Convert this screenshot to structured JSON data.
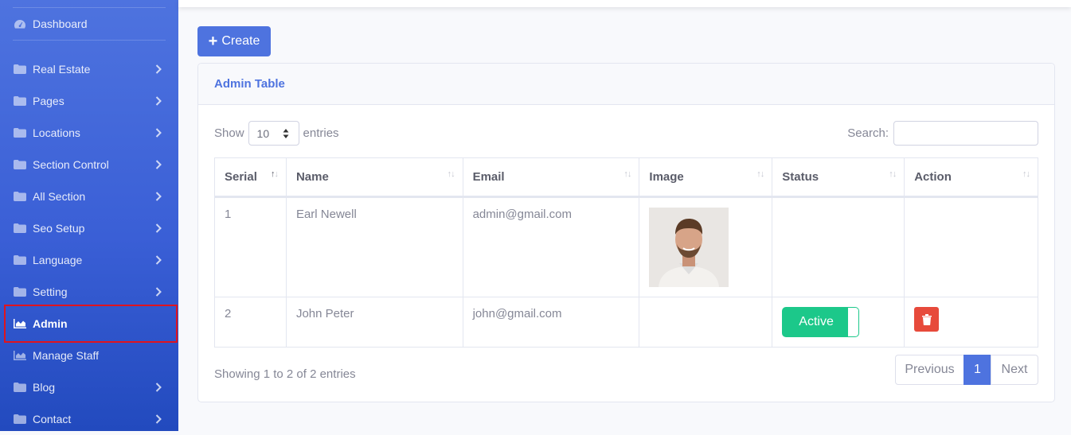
{
  "sidebar": {
    "items": [
      {
        "label": "Dashboard",
        "icon": "tachometer-icon",
        "submenu": false
      },
      {
        "label": "Real Estate",
        "icon": "folder-icon",
        "submenu": true
      },
      {
        "label": "Pages",
        "icon": "folder-icon",
        "submenu": true
      },
      {
        "label": "Locations",
        "icon": "folder-icon",
        "submenu": true
      },
      {
        "label": "Section Control",
        "icon": "folder-icon",
        "submenu": true
      },
      {
        "label": "All Section",
        "icon": "folder-icon",
        "submenu": true
      },
      {
        "label": "Seo Setup",
        "icon": "folder-icon",
        "submenu": true
      },
      {
        "label": "Language",
        "icon": "folder-icon",
        "submenu": true
      },
      {
        "label": "Setting",
        "icon": "folder-icon",
        "submenu": true
      },
      {
        "label": "Admin",
        "icon": "chart-area-icon",
        "submenu": false,
        "active": true
      },
      {
        "label": "Manage Staff",
        "icon": "chart-area-icon",
        "submenu": false
      },
      {
        "label": "Blog",
        "icon": "folder-icon",
        "submenu": true
      },
      {
        "label": "Contact",
        "icon": "folder-icon",
        "submenu": true
      }
    ]
  },
  "toolbar": {
    "create_label": "Create",
    "create_icon": "plus-icon"
  },
  "card": {
    "title": "Admin Table"
  },
  "datatable": {
    "show_label": "Show",
    "entries_label": "entries",
    "page_length": "10",
    "search_label": "Search:",
    "search_value": "",
    "columns": [
      "Serial",
      "Name",
      "Email",
      "Image",
      "Status",
      "Action"
    ],
    "rows": [
      {
        "serial": "1",
        "name": "Earl Newell",
        "email": "admin@gmail.com",
        "image": "admin-photo",
        "status": "",
        "action": ""
      },
      {
        "serial": "2",
        "name": "John Peter",
        "email": "john@gmail.com",
        "image": "",
        "status": "Active",
        "action": "delete"
      }
    ],
    "info": "Showing 1 to 2 of 2 entries",
    "pagination": {
      "previous": "Previous",
      "current": "1",
      "next": "Next"
    }
  },
  "colors": {
    "primary": "#4e73df",
    "success": "#1cc88a",
    "danger": "#e74a3b",
    "highlight": "#e0141e"
  }
}
